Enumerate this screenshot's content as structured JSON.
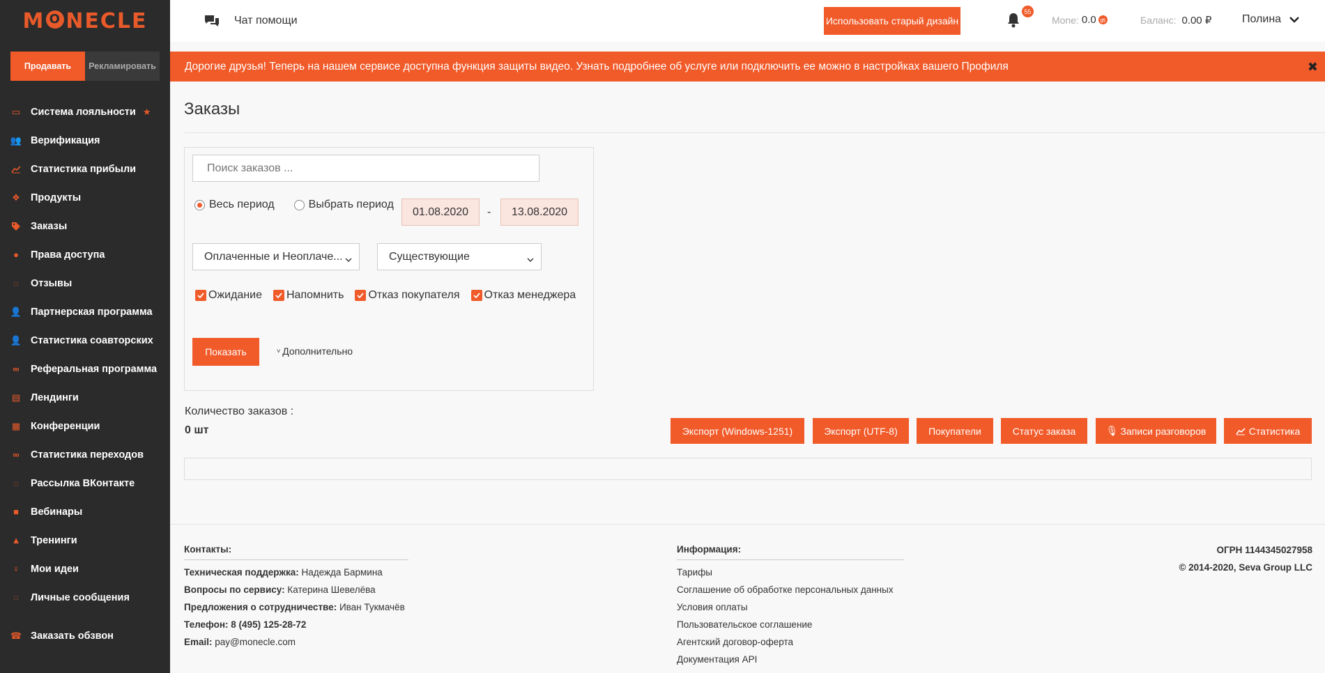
{
  "logo": {
    "text_before": "M",
    "text_o": "O",
    "text_after": "NECLE"
  },
  "switcher": {
    "sell": "Продавать",
    "advertise": "Рекламировать"
  },
  "sidebar": {
    "items": [
      {
        "label": "Система лояльности",
        "icon": "loyalty-icon"
      },
      {
        "label": "Верификация",
        "icon": "users-icon"
      },
      {
        "label": "Статистика прибыли",
        "icon": "chart-line-icon"
      },
      {
        "label": "Продукты",
        "icon": "cubes-icon"
      },
      {
        "label": "Заказы",
        "icon": "tags-icon"
      },
      {
        "label": "Права доступа",
        "icon": "lock-icon"
      },
      {
        "label": "Отзывы",
        "icon": "comments-icon"
      },
      {
        "label": "Партнерская программа",
        "icon": "user-plus-icon"
      },
      {
        "label": "Статистика соавторских",
        "icon": "user-plus-icon"
      },
      {
        "label": "Реферальная программа",
        "icon": "link-icon"
      },
      {
        "label": "Лендинги",
        "icon": "file-icon"
      },
      {
        "label": "Конференции",
        "icon": "calendar-icon"
      },
      {
        "label": "Статистика переходов",
        "icon": "link-icon"
      },
      {
        "label": "Рассылка ВКонтакте",
        "icon": "comments-icon"
      },
      {
        "label": "Вебинары",
        "icon": "video-icon"
      },
      {
        "label": "Тренинги",
        "icon": "graduation-icon"
      },
      {
        "label": "Мои идеи",
        "icon": "lightbulb-icon"
      },
      {
        "label": "Личные сообщения",
        "icon": "comments-icon"
      }
    ],
    "bottom": {
      "label": "Заказать обзвон",
      "icon": "phone-icon"
    }
  },
  "topbar": {
    "chat": "Чат помощи",
    "old_design": "Использовать старый дизайн",
    "notifications": "55",
    "mone_label": "Mone:",
    "mone_value": "0.0",
    "balance_label": "Баланс:",
    "balance_value": "0.00 ₽",
    "user": "Полина"
  },
  "banner": {
    "text": "Дорогие друзья! Теперь на нашем сервисе доступна функция защиты видео. Узнать подробнее об услуге или подключить ее можно в настройках вашего Профиля",
    "close": "✖"
  },
  "page": {
    "title": "Заказы"
  },
  "filters": {
    "search_placeholder": "Поиск заказов ...",
    "all_period": "Весь период",
    "choose_period": "Выбрать период",
    "date_from": "01.08.2020",
    "date_sep": "-",
    "date_to": "13.08.2020",
    "payment_select": "Оплаченные и Неоплаче...",
    "existence_select": "Существующие",
    "checkboxes": [
      "Ожидание",
      "Напомнить",
      "Отказ покупателя",
      "Отказ менеджера"
    ],
    "show": "Показать",
    "more": "Дополнительно"
  },
  "summary": {
    "count_label": "Количество заказов :",
    "count_value": "0 шт"
  },
  "actions": {
    "export_win": "Экспорт (Windows-1251)",
    "export_utf": "Экспорт (UTF-8)",
    "buyers": "Покупатели",
    "order_status": "Статус заказа",
    "recordings": "Записи разговоров",
    "statistics": "Статистика"
  },
  "footer": {
    "contacts_title": "Контакты:",
    "support_label": "Техническая поддержка:",
    "support_name": "Надежда Бармина",
    "service_label": "Вопросы по сервису:",
    "service_name": "Катерина Шевелёва",
    "coop_label": "Предложения о сотрудничестве:",
    "coop_name": "Иван Тукмачёв",
    "phone_label": "Телефон:",
    "phone_value": "8 (495) 125-28-72",
    "email_label": "Email:",
    "email_value": "pay@monecle.com",
    "info_title": "Информация:",
    "info_links": [
      "Тарифы",
      "Соглашение об обработке персональных данных",
      "Условия оплаты",
      "Пользовательское соглашение",
      "Агентский договор-оферта",
      "Документация API"
    ],
    "ogrn": "ОГРН 1144345027958",
    "copyright": "© 2014-2020, Seva Group LLC"
  },
  "colors": {
    "accent": "#f15a29",
    "sidebar": "#2b2b2b"
  }
}
